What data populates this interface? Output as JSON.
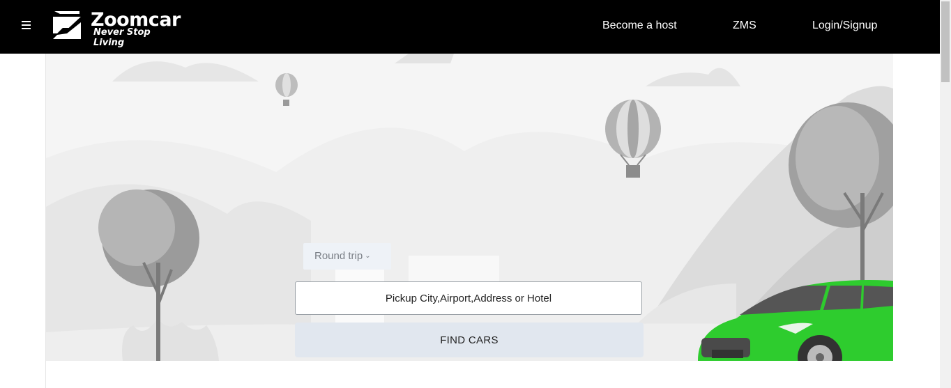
{
  "header": {
    "menu_icon": "hamburger-menu-icon",
    "logo_icon": "zoomcar-z-logo-icon",
    "brand_name": "Zoomcar",
    "tagline": "Never Stop Living",
    "nav": [
      {
        "label": "Become a host"
      },
      {
        "label": "ZMS"
      },
      {
        "label": "Login/Signup"
      }
    ]
  },
  "search": {
    "trip_type": "Round trip",
    "trip_type_icon": "chevron-down-icon",
    "pickup_placeholder": "Pickup City,Airport,Address or Hotel",
    "find_button": "FIND CARS"
  },
  "colors": {
    "header_bg": "#000000",
    "car_green": "#2ecc2e",
    "button_bg": "#e1e7ef"
  }
}
